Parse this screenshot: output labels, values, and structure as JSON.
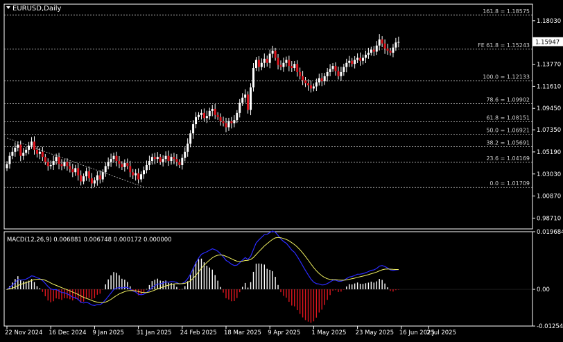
{
  "window": {
    "symbol_title": "EURUSD,Daily",
    "macd_label": "MACD(12,26,9) 0.006881 0.006748 0.000172 0.000000"
  },
  "chart_data": [
    {
      "type": "candlestick",
      "title": "EURUSD,Daily",
      "ylim": [
        0.9765,
        1.1965
      ],
      "price_ticks": [
        "1.18030",
        "1.15947",
        "1.13770",
        "1.11610",
        "1.09450",
        "1.07350",
        "1.05190",
        "1.03030",
        "1.00870",
        "0.98710"
      ],
      "current_price": "1.15947",
      "x_ticks": [
        {
          "date": "22 Nov 2024",
          "index": 0
        },
        {
          "date": "16 Dec 2024",
          "index": 16
        },
        {
          "date": "9 Jan 2025",
          "index": 32
        },
        {
          "date": "31 Jan 2025",
          "index": 48
        },
        {
          "date": "24 Feb 2025",
          "index": 64
        },
        {
          "date": "18 Mar 2025",
          "index": 80
        },
        {
          "date": "9 Apr 2025",
          "index": 96
        },
        {
          "date": "1 May 2025",
          "index": 112
        },
        {
          "date": "23 May 2025",
          "index": 128
        },
        {
          "date": "16 Jun 2025",
          "index": 144
        },
        {
          "date": "2 Jul 2025",
          "index": 154
        }
      ],
      "levels": [
        {
          "label": "161.8 = 1.18575",
          "value": 1.18575
        },
        {
          "label": "FE 61.8 = 1.15243",
          "value": 1.15243
        },
        {
          "label": "100.0 = 1.12133",
          "value": 1.12133
        },
        {
          "label": "78.6 = 1.09902",
          "value": 1.09902
        },
        {
          "label": "61.8 = 1.08151",
          "value": 1.08151
        },
        {
          "label": "50.0 = 1.06921",
          "value": 1.06921
        },
        {
          "label": "38.2 = 1.05691",
          "value": 1.05691
        },
        {
          "label": "23.6 = 1.04169",
          "value": 1.04169
        },
        {
          "label": "0.0 = 1.01709",
          "value": 1.01709
        }
      ],
      "trendline": [
        [
          0,
          1.0655
        ],
        [
          50,
          1.0175
        ]
      ],
      "closes": [
        1.04,
        1.048,
        1.052,
        1.056,
        1.059,
        1.048,
        1.051,
        1.054,
        1.058,
        1.062,
        1.054,
        1.05,
        1.052,
        1.047,
        1.042,
        1.038,
        1.039,
        1.043,
        1.047,
        1.04,
        1.038,
        1.042,
        1.038,
        1.035,
        1.032,
        1.036,
        1.029,
        1.023,
        1.028,
        1.033,
        1.026,
        1.021,
        1.024,
        1.029,
        1.025,
        1.032,
        1.038,
        1.042,
        1.045,
        1.048,
        1.043,
        1.04,
        1.037,
        1.041,
        1.038,
        1.032,
        1.029,
        1.031,
        1.025,
        1.03,
        1.034,
        1.039,
        1.043,
        1.047,
        1.045,
        1.047,
        1.042,
        1.045,
        1.048,
        1.043,
        1.047,
        1.045,
        1.042,
        1.039,
        1.046,
        1.052,
        1.06,
        1.07,
        1.079,
        1.086,
        1.088,
        1.09,
        1.085,
        1.087,
        1.092,
        1.094,
        1.088,
        1.086,
        1.082,
        1.08,
        1.076,
        1.082,
        1.08,
        1.083,
        1.09,
        1.1,
        1.105,
        1.108,
        1.093,
        1.115,
        1.134,
        1.142,
        1.135,
        1.139,
        1.143,
        1.139,
        1.148,
        1.151,
        1.144,
        1.137,
        1.135,
        1.139,
        1.142,
        1.136,
        1.134,
        1.138,
        1.13,
        1.126,
        1.122,
        1.119,
        1.117,
        1.114,
        1.116,
        1.12,
        1.124,
        1.121,
        1.126,
        1.13,
        1.133,
        1.136,
        1.131,
        1.126,
        1.13,
        1.135,
        1.139,
        1.141,
        1.138,
        1.142,
        1.144,
        1.141,
        1.144,
        1.147,
        1.149,
        1.152,
        1.15,
        1.156,
        1.162,
        1.158,
        1.153,
        1.151,
        1.149,
        1.154,
        1.159,
        1.1595
      ],
      "macd": {
        "ylim": [
          -0.012547,
          0.019684
        ],
        "ticks": [
          "0.019684",
          "0.00",
          "-0.012547"
        ],
        "signal_label": "0.006748"
      }
    }
  ]
}
